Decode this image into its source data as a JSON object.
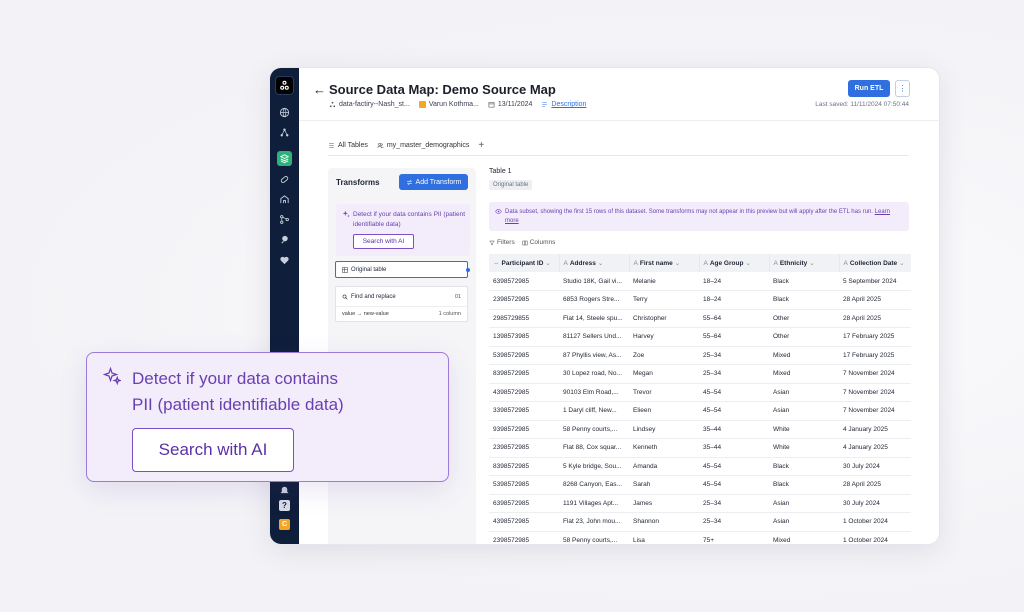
{
  "header": {
    "title": "Source Data Map: Demo Source Map",
    "back_label": "←",
    "meta_pipeline": "data-factiry--Nash_st...",
    "meta_user": "Varun Kothma...",
    "meta_date": "13/11/2024",
    "meta_description": "Description",
    "run_label": "Run ETL",
    "more_label": "⋮",
    "last_saved": "Last saved: 11/11/2024 07:50:44"
  },
  "tabs": {
    "all_tables": "All Tables",
    "active": "my_master_demographics",
    "add": "+"
  },
  "transforms": {
    "title": "Transforms",
    "add_label": "Add Transform",
    "pii_text": "Detect if your data contains PII (patient identifiable data)",
    "pii_button": "Search with AI",
    "original_table": "Original table",
    "find_replace": "Find and replace",
    "find_num": "01",
    "expr_from": "value",
    "expr_to": "new-value",
    "expr_cols": "1 column"
  },
  "table_area": {
    "label": "Table 1",
    "tag": "Original table",
    "notice": "Data subset, showing the first 15 rows of this dataset. Some transforms may not appear in this preview but will apply after the ETL has run.",
    "learn_more": "Learn more",
    "filters": "Filters",
    "columns": "Columns"
  },
  "grid": {
    "headers": [
      "Participant ID",
      "Address",
      "First name",
      "Age Group",
      "Ethnicity",
      "Collection Date"
    ],
    "rows": [
      [
        "6398572985",
        "Studio 18K, Gail vi...",
        "Melanie",
        "18–24",
        "Black",
        "5 September 2024"
      ],
      [
        "2398572985",
        "6853 Rogers Stre...",
        "Terry",
        "18–24",
        "Black",
        "28 April 2025"
      ],
      [
        "2985729855",
        "Flat 14, Steele spu...",
        "Christopher",
        "55–64",
        "Other",
        "28 April 2025"
      ],
      [
        "1398573985",
        "81127 Sellers Und...",
        "Harvey",
        "55–64",
        "Other",
        "17 February 2025"
      ],
      [
        "5398572985",
        "87 Phyllis view, As...",
        "Zoe",
        "25–34",
        "Mixed",
        "17 February 2025"
      ],
      [
        "8398572985",
        "30 Lopez road, No...",
        "Megan",
        "25–34",
        "Mixed",
        "7 November 2024"
      ],
      [
        "4398572985",
        "90103 Elm Road,...",
        "Trevor",
        "45–54",
        "Asian",
        "7 November 2024"
      ],
      [
        "3398572985",
        "1 Daryl cliff, New...",
        "Elieen",
        "45–54",
        "Asian",
        "7 November 2024"
      ],
      [
        "9398572985",
        "58 Penny courts,...",
        "Lindsey",
        "35–44",
        "White",
        "4 January 2025"
      ],
      [
        "2398572985",
        "Flat 88, Cox squar...",
        "Kenneth",
        "35–44",
        "White",
        "4 January 2025"
      ],
      [
        "8398572985",
        "5 Kyle bridge, Sou...",
        "Amanda",
        "45–54",
        "Black",
        "30 July 2024"
      ],
      [
        "5398572985",
        "8268 Canyon, Eas...",
        "Sarah",
        "45–54",
        "Black",
        "28 April 2025"
      ],
      [
        "6398572985",
        "1191 Villages Apt...",
        "James",
        "25–34",
        "Asian",
        "30 July 2024"
      ],
      [
        "4398572985",
        "Flat 23, John mou...",
        "Shannon",
        "25–34",
        "Asian",
        "1 October 2024"
      ],
      [
        "2398572985",
        "58 Penny courts,...",
        "Lisa",
        "75+",
        "Mixed",
        "1 October 2024"
      ]
    ]
  },
  "callout": {
    "line1": "Detect if your data contains",
    "line2": "PII (patient identifiable data)",
    "button": "Search with AI"
  },
  "rail": {
    "help": "?",
    "user_initial": "C"
  },
  "colors": {
    "accent": "#2f6fe0",
    "rail": "#0f1e3a",
    "purple": "#6a3fb0",
    "active_nav": "#2db37a"
  }
}
